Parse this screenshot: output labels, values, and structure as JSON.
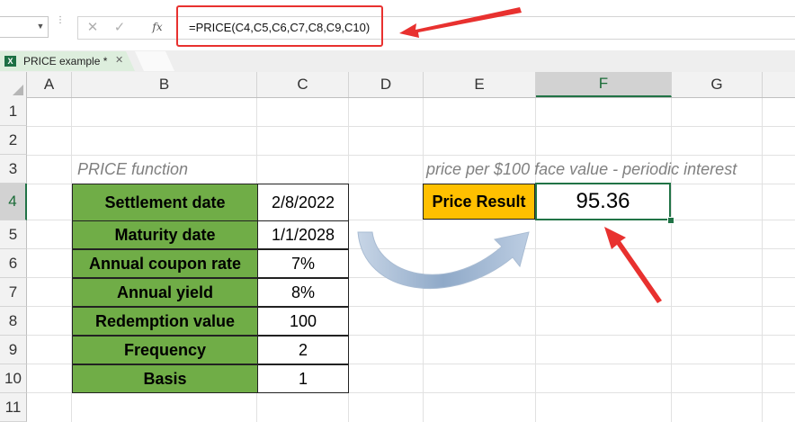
{
  "formula_bar": {
    "name_box_value": "",
    "cancel_icon": "✕",
    "enter_icon": "✓",
    "fx_label": "fx",
    "formula": "=PRICE(C4,C5,C6,C7,C8,C9,C10)"
  },
  "sheet_tab": {
    "label": "PRICE example *",
    "close_icon": "✕",
    "file_icon": "X"
  },
  "columns": [
    "A",
    "B",
    "C",
    "D",
    "E",
    "F",
    "G"
  ],
  "rows": [
    "1",
    "2",
    "3",
    "4",
    "5",
    "6",
    "7",
    "8",
    "9",
    "10",
    "11"
  ],
  "b3_text": "PRICE function",
  "e3_text": "price per $100 face value - periodic interest",
  "inputs": [
    {
      "label": "Settlement date",
      "value": "2/8/2022"
    },
    {
      "label": "Maturity date",
      "value": "1/1/2028"
    },
    {
      "label": "Annual coupon rate",
      "value": "7%"
    },
    {
      "label": "Annual yield",
      "value": "8%"
    },
    {
      "label": "Redemption value",
      "value": "100"
    },
    {
      "label": "Frequency",
      "value": "2"
    },
    {
      "label": "Basis",
      "value": "1"
    }
  ],
  "result": {
    "label": "Price Result",
    "value": "95.36"
  },
  "colors": {
    "label_fill": "#70ad47",
    "result_label_fill": "#ffc000",
    "selection": "#217346",
    "annotation": "#e8312f",
    "curve_arrow": "#9bb3d0"
  }
}
